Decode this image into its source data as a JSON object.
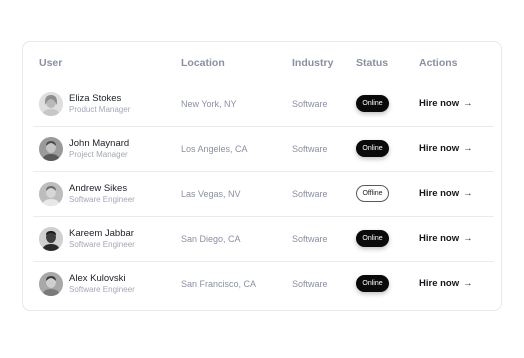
{
  "table": {
    "headers": {
      "user": "User",
      "location": "Location",
      "industry": "Industry",
      "status": "Status",
      "actions": "Actions"
    },
    "action_label": "Hire now",
    "action_icon": "arrow-right-icon",
    "rows": [
      {
        "name": "Eliza Stokes",
        "role": "Product Manager",
        "location": "New York, NY",
        "industry": "Software",
        "status": "Online"
      },
      {
        "name": "John Maynard",
        "role": "Project Manager",
        "location": "Los Angeles, CA",
        "industry": "Software",
        "status": "Online"
      },
      {
        "name": "Andrew Sikes",
        "role": "Software Engineer",
        "location": "Las Vegas, NV",
        "industry": "Software",
        "status": "Offline"
      },
      {
        "name": "Kareem Jabbar",
        "role": "Software Engineer",
        "location": "San Diego, CA",
        "industry": "Software",
        "status": "Online"
      },
      {
        "name": "Alex Kulovski",
        "role": "Software Engineer",
        "location": "San Francisco, CA",
        "industry": "Software",
        "status": "Online"
      }
    ]
  },
  "colors": {
    "online_bg": "#0a0a0a",
    "offline_border": "#5a5a5a",
    "header_text": "#8a90a2"
  }
}
